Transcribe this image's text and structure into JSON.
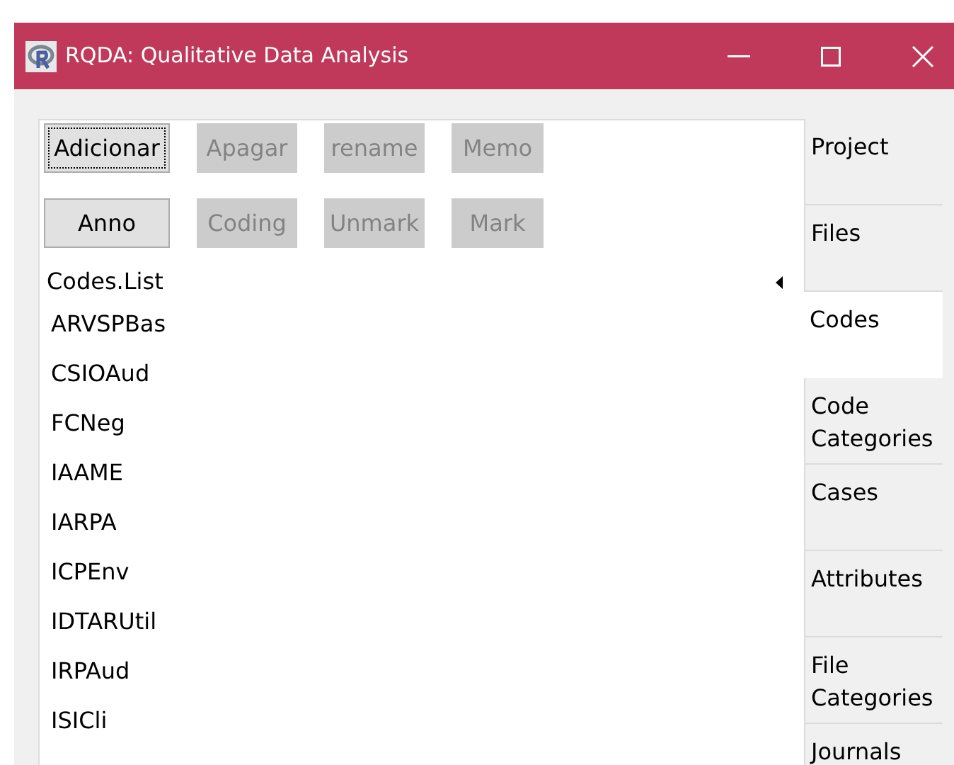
{
  "window": {
    "title": "RQDA: Qualitative Data Analysis"
  },
  "buttons": [
    {
      "label": "Adicionar",
      "disabled": false,
      "focused": true
    },
    {
      "label": "Apagar",
      "disabled": true,
      "focused": false
    },
    {
      "label": "rename",
      "disabled": true,
      "focused": false
    },
    {
      "label": "Memo",
      "disabled": true,
      "focused": false
    },
    {
      "label": "Anno",
      "disabled": false,
      "focused": false
    },
    {
      "label": "Coding",
      "disabled": true,
      "focused": false
    },
    {
      "label": "Unmark",
      "disabled": true,
      "focused": false
    },
    {
      "label": "Mark",
      "disabled": true,
      "focused": false
    }
  ],
  "codes_list": {
    "header": "Codes.List",
    "items": [
      "ARVSPBas",
      "CSIOAud",
      "FCNeg",
      "IAAME",
      "IARPA",
      "ICPEnv",
      "IDTARUtil",
      "IRPAud",
      "ISICli"
    ]
  },
  "tabs": [
    {
      "label": "Project",
      "selected": false
    },
    {
      "label": "Files",
      "selected": false
    },
    {
      "label": "Codes",
      "selected": true
    },
    {
      "label": "Code Categories",
      "selected": false
    },
    {
      "label": "Cases",
      "selected": false
    },
    {
      "label": "Attributes",
      "selected": false
    },
    {
      "label": "File Categories",
      "selected": false
    },
    {
      "label": "Journals",
      "selected": false
    }
  ]
}
